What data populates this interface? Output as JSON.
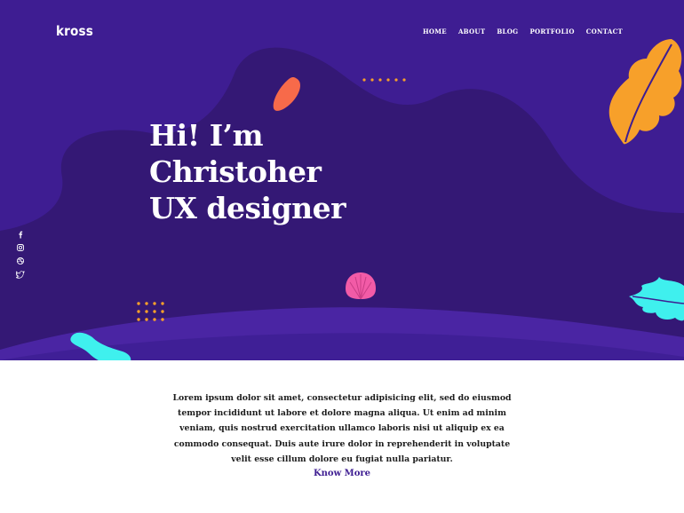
{
  "brand": {
    "logo": "kross"
  },
  "nav": {
    "items": [
      "HOME",
      "ABOUT",
      "BLOG",
      "PORTFOLIO",
      "CONTACT"
    ]
  },
  "hero": {
    "lines": [
      "Hi! I’m",
      "Christoher",
      "UX designer"
    ]
  },
  "social": {
    "icons": [
      "facebook-icon",
      "instagram-icon",
      "dribbble-icon",
      "twitter-icon"
    ]
  },
  "intro": {
    "text": "Lorem ipsum dolor sit amet, consectetur adipisicing elit, sed do eiusmod tempor incididunt ut labore et dolore magna aliqua. Ut enim ad minim veniam, quis nostrud exercitation ullamco laboris nisi ut aliquip ex ea commodo consequat. Duis aute irure dolor in reprehenderit in voluptate velit esse cillum dolore eu fugiat nulla pariatur.",
    "cta": "Know More"
  },
  "colors": {
    "hero_bg": "#3e1d92",
    "hero_shape": "#341875",
    "orange": "#f7a02a",
    "coral": "#f76a4a",
    "pink": "#f25ba7",
    "cyan": "#3ff0ee",
    "accent": "#3e1d92"
  }
}
